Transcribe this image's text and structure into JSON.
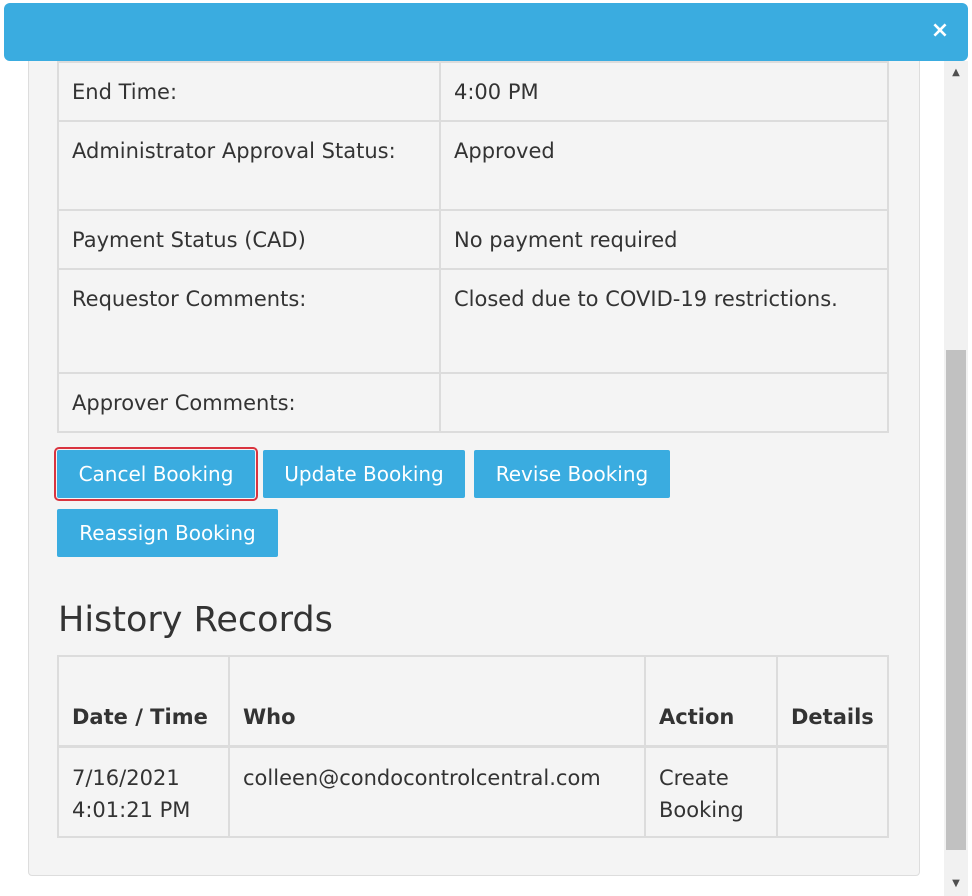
{
  "header": {
    "close_label": "×"
  },
  "details": {
    "rows": [
      {
        "label": "End Time:",
        "value": "4:00 PM"
      },
      {
        "label": "Administrator Approval Status:",
        "value": "Approved"
      },
      {
        "label": "Payment Status (CAD)",
        "value": "No payment required"
      },
      {
        "label": "Requestor Comments:",
        "value": "Closed due to COVID-19 restrictions."
      },
      {
        "label": "Approver Comments:",
        "value": ""
      }
    ]
  },
  "actions": {
    "cancel": "Cancel Booking",
    "update": "Update Booking",
    "revise": "Revise Booking",
    "reassign": "Reassign Booking"
  },
  "history": {
    "title": "History Records",
    "columns": [
      "Date / Time",
      "Who",
      "Action",
      "Details"
    ],
    "rows": [
      {
        "date_time": "7/16/2021 4:01:21 PM",
        "who": "colleen@condocontrolcentral.com",
        "action": "Create Booking",
        "details": ""
      }
    ]
  },
  "colors": {
    "accent": "#3aace0",
    "highlight_outline": "#d9343f",
    "panel_bg": "#f4f4f4"
  }
}
